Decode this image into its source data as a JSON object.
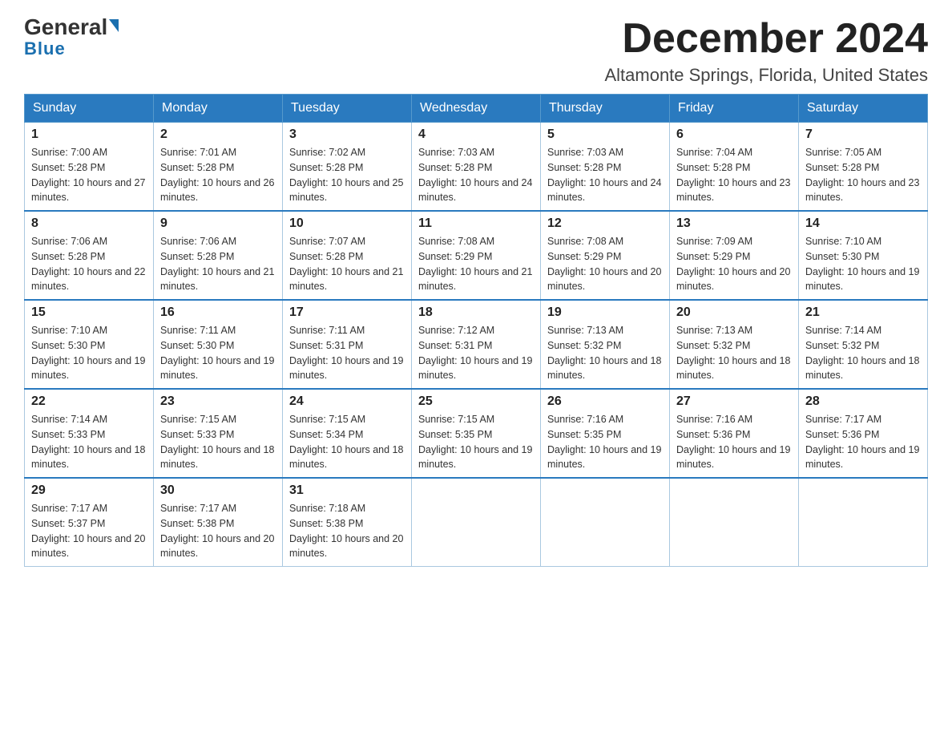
{
  "header": {
    "logo_general": "General",
    "logo_blue": "Blue",
    "month_title": "December 2024",
    "location": "Altamonte Springs, Florida, United States"
  },
  "weekdays": [
    "Sunday",
    "Monday",
    "Tuesday",
    "Wednesday",
    "Thursday",
    "Friday",
    "Saturday"
  ],
  "weeks": [
    [
      {
        "day": "1",
        "sunrise": "7:00 AM",
        "sunset": "5:28 PM",
        "daylight": "10 hours and 27 minutes."
      },
      {
        "day": "2",
        "sunrise": "7:01 AM",
        "sunset": "5:28 PM",
        "daylight": "10 hours and 26 minutes."
      },
      {
        "day": "3",
        "sunrise": "7:02 AM",
        "sunset": "5:28 PM",
        "daylight": "10 hours and 25 minutes."
      },
      {
        "day": "4",
        "sunrise": "7:03 AM",
        "sunset": "5:28 PM",
        "daylight": "10 hours and 24 minutes."
      },
      {
        "day": "5",
        "sunrise": "7:03 AM",
        "sunset": "5:28 PM",
        "daylight": "10 hours and 24 minutes."
      },
      {
        "day": "6",
        "sunrise": "7:04 AM",
        "sunset": "5:28 PM",
        "daylight": "10 hours and 23 minutes."
      },
      {
        "day": "7",
        "sunrise": "7:05 AM",
        "sunset": "5:28 PM",
        "daylight": "10 hours and 23 minutes."
      }
    ],
    [
      {
        "day": "8",
        "sunrise": "7:06 AM",
        "sunset": "5:28 PM",
        "daylight": "10 hours and 22 minutes."
      },
      {
        "day": "9",
        "sunrise": "7:06 AM",
        "sunset": "5:28 PM",
        "daylight": "10 hours and 21 minutes."
      },
      {
        "day": "10",
        "sunrise": "7:07 AM",
        "sunset": "5:28 PM",
        "daylight": "10 hours and 21 minutes."
      },
      {
        "day": "11",
        "sunrise": "7:08 AM",
        "sunset": "5:29 PM",
        "daylight": "10 hours and 21 minutes."
      },
      {
        "day": "12",
        "sunrise": "7:08 AM",
        "sunset": "5:29 PM",
        "daylight": "10 hours and 20 minutes."
      },
      {
        "day": "13",
        "sunrise": "7:09 AM",
        "sunset": "5:29 PM",
        "daylight": "10 hours and 20 minutes."
      },
      {
        "day": "14",
        "sunrise": "7:10 AM",
        "sunset": "5:30 PM",
        "daylight": "10 hours and 19 minutes."
      }
    ],
    [
      {
        "day": "15",
        "sunrise": "7:10 AM",
        "sunset": "5:30 PM",
        "daylight": "10 hours and 19 minutes."
      },
      {
        "day": "16",
        "sunrise": "7:11 AM",
        "sunset": "5:30 PM",
        "daylight": "10 hours and 19 minutes."
      },
      {
        "day": "17",
        "sunrise": "7:11 AM",
        "sunset": "5:31 PM",
        "daylight": "10 hours and 19 minutes."
      },
      {
        "day": "18",
        "sunrise": "7:12 AM",
        "sunset": "5:31 PM",
        "daylight": "10 hours and 19 minutes."
      },
      {
        "day": "19",
        "sunrise": "7:13 AM",
        "sunset": "5:32 PM",
        "daylight": "10 hours and 18 minutes."
      },
      {
        "day": "20",
        "sunrise": "7:13 AM",
        "sunset": "5:32 PM",
        "daylight": "10 hours and 18 minutes."
      },
      {
        "day": "21",
        "sunrise": "7:14 AM",
        "sunset": "5:32 PM",
        "daylight": "10 hours and 18 minutes."
      }
    ],
    [
      {
        "day": "22",
        "sunrise": "7:14 AM",
        "sunset": "5:33 PM",
        "daylight": "10 hours and 18 minutes."
      },
      {
        "day": "23",
        "sunrise": "7:15 AM",
        "sunset": "5:33 PM",
        "daylight": "10 hours and 18 minutes."
      },
      {
        "day": "24",
        "sunrise": "7:15 AM",
        "sunset": "5:34 PM",
        "daylight": "10 hours and 18 minutes."
      },
      {
        "day": "25",
        "sunrise": "7:15 AM",
        "sunset": "5:35 PM",
        "daylight": "10 hours and 19 minutes."
      },
      {
        "day": "26",
        "sunrise": "7:16 AM",
        "sunset": "5:35 PM",
        "daylight": "10 hours and 19 minutes."
      },
      {
        "day": "27",
        "sunrise": "7:16 AM",
        "sunset": "5:36 PM",
        "daylight": "10 hours and 19 minutes."
      },
      {
        "day": "28",
        "sunrise": "7:17 AM",
        "sunset": "5:36 PM",
        "daylight": "10 hours and 19 minutes."
      }
    ],
    [
      {
        "day": "29",
        "sunrise": "7:17 AM",
        "sunset": "5:37 PM",
        "daylight": "10 hours and 20 minutes."
      },
      {
        "day": "30",
        "sunrise": "7:17 AM",
        "sunset": "5:38 PM",
        "daylight": "10 hours and 20 minutes."
      },
      {
        "day": "31",
        "sunrise": "7:18 AM",
        "sunset": "5:38 PM",
        "daylight": "10 hours and 20 minutes."
      },
      null,
      null,
      null,
      null
    ]
  ],
  "labels": {
    "sunrise_prefix": "Sunrise: ",
    "sunset_prefix": "Sunset: ",
    "daylight_prefix": "Daylight: "
  }
}
